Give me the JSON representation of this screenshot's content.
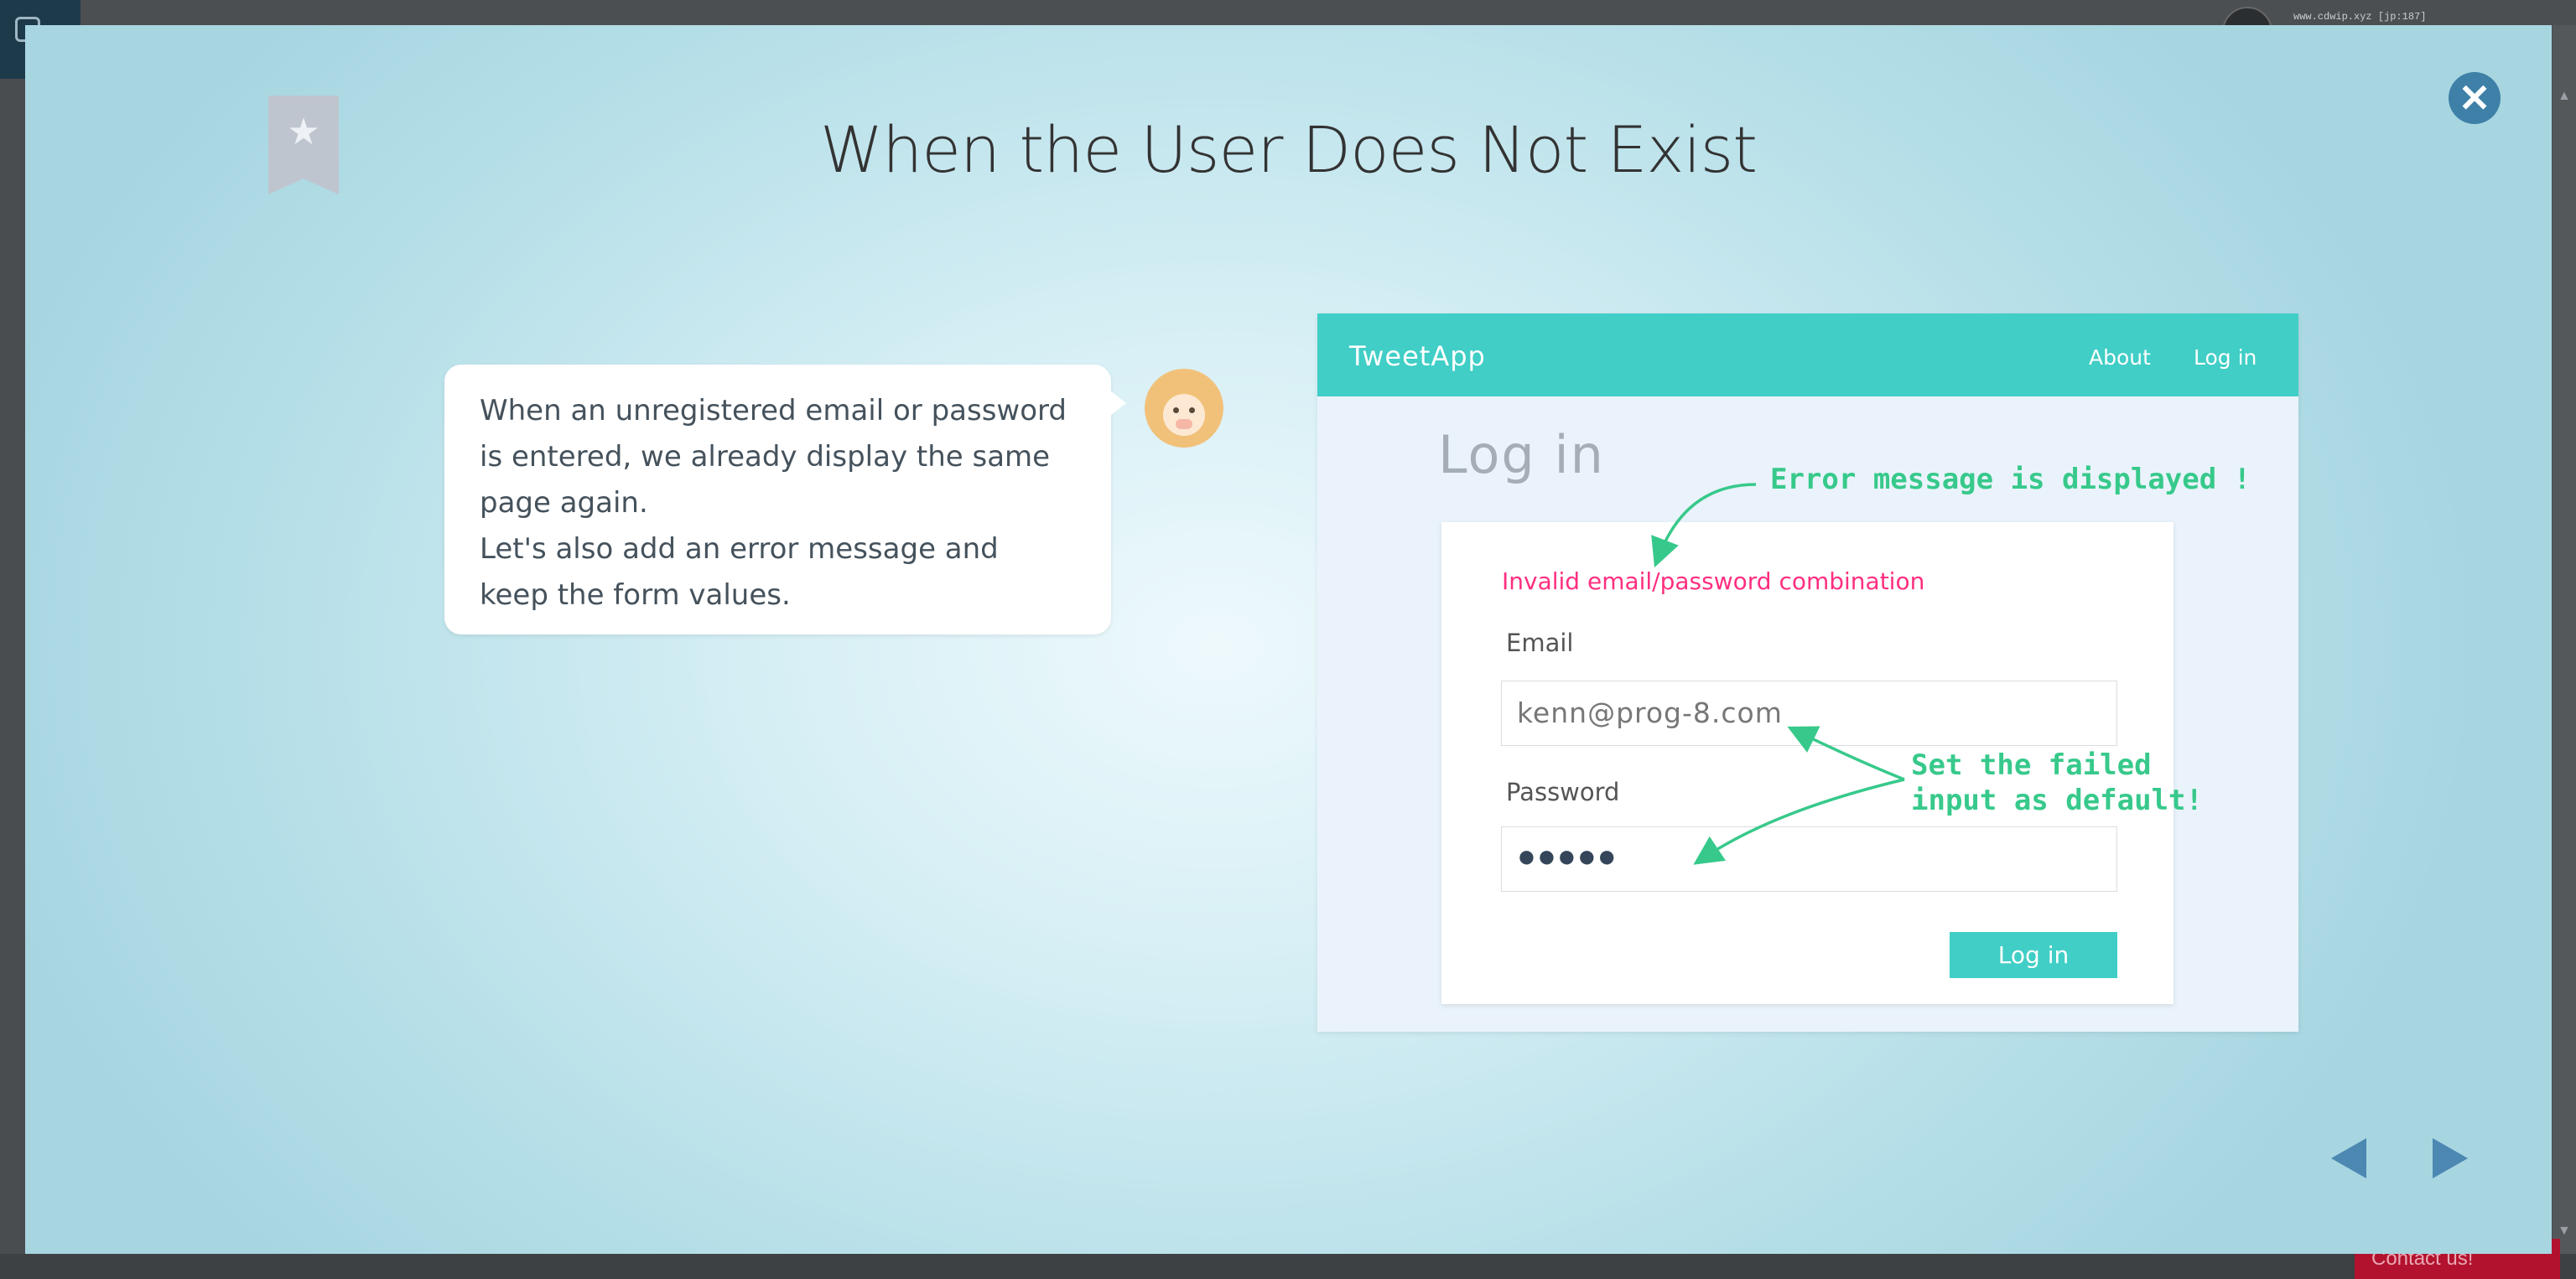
{
  "background": {
    "url_text": "www.cdwip.xyz [jp:187]",
    "contact_label": "Contact us!"
  },
  "modal": {
    "title": "When the User Does Not Exist",
    "close_icon": "close-icon",
    "bookmark_icon": "star-bookmark-icon"
  },
  "bubble": {
    "line1": "When an unregistered email or password is entered, we already display the same page again.",
    "line2": "Let's also add an error message and keep the form values."
  },
  "screenshot": {
    "brand": "TweetApp",
    "nav": {
      "about": "About",
      "login": "Log in"
    },
    "heading": "Log in",
    "error_message": "Invalid email/password combination",
    "email_label": "Email",
    "email_value": "kenn@prog-8.com",
    "password_label": "Password",
    "password_value": "●●●●●",
    "login_button": "Log in",
    "annotation_error": "Error message is displayed !",
    "annotation_default_1": "Set the failed",
    "annotation_default_2": "input as default!"
  },
  "colors": {
    "accent": "#40cec6",
    "error": "#ff2f80",
    "annotation": "#37c98b",
    "nav_arrow": "#4d88b2"
  }
}
